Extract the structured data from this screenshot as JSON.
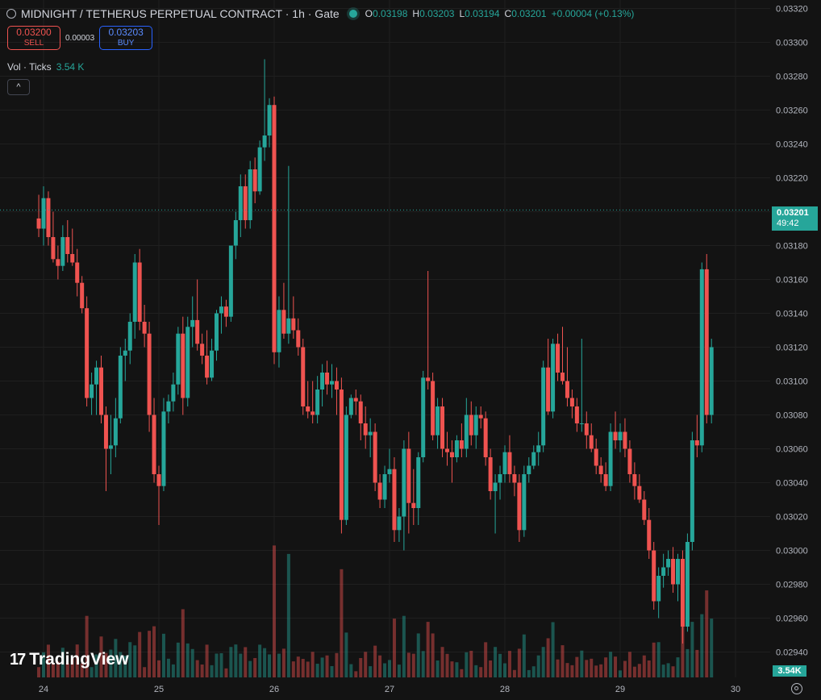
{
  "header": {
    "title": "MIDNIGHT / TETHERUS PERPETUAL CONTRACT · 1h · Gate",
    "ohlc": [
      {
        "label": "O",
        "value": "0.03198"
      },
      {
        "label": "H",
        "value": "0.03203"
      },
      {
        "label": "L",
        "value": "0.03194"
      },
      {
        "label": "C",
        "value": "0.03201"
      }
    ],
    "change": "+0.00004 (+0.13%)"
  },
  "trade": {
    "sell_price": "0.03200",
    "sell_label": "SELL",
    "spread": "0.00003",
    "buy_price": "0.03203",
    "buy_label": "BUY"
  },
  "volume": {
    "label": "Vol · Ticks",
    "value": "3.54 K",
    "tag": "3.54K"
  },
  "collapse_icon": "^",
  "last_price": {
    "value": "0.03201",
    "countdown": "49:42"
  },
  "logo": {
    "mark": "17",
    "text": "TradingView"
  },
  "colors": {
    "up": "#26a69a",
    "down": "#ef5350",
    "background": "#131313",
    "grid": "#1f1f1f"
  },
  "icons": [
    "eye-icon",
    "gear-icon",
    "chevron-up-icon"
  ],
  "chart_data": {
    "type": "candlestick",
    "interval": "1h",
    "ylim": [
      0.02925,
      0.03325
    ],
    "y_ticks": [
      "0.03320",
      "0.03300",
      "0.03280",
      "0.03260",
      "0.03240",
      "0.03220",
      "0.03200",
      "0.03180",
      "0.03160",
      "0.03140",
      "0.03120",
      "0.03100",
      "0.03080",
      "0.03060",
      "0.03040",
      "0.03020",
      "0.03000",
      "0.02980",
      "0.02960",
      "0.02940"
    ],
    "x_ticks": [
      "24",
      "25",
      "26",
      "27",
      "28",
      "29",
      "30"
    ],
    "x_ticks_start_hour": 0,
    "first_candle_hour": -1,
    "hours": 140,
    "ohlc": [
      [
        0.03196,
        0.0321,
        0.03185,
        0.0319
      ],
      [
        0.0319,
        0.03215,
        0.0318,
        0.03208
      ],
      [
        0.03208,
        0.03212,
        0.0318,
        0.03185
      ],
      [
        0.03185,
        0.032,
        0.0317,
        0.03172
      ],
      [
        0.03172,
        0.0318,
        0.0316,
        0.03168
      ],
      [
        0.03168,
        0.03192,
        0.03165,
        0.03185
      ],
      [
        0.03185,
        0.03195,
        0.0317,
        0.03175
      ],
      [
        0.03175,
        0.0319,
        0.03168,
        0.0317
      ],
      [
        0.0317,
        0.03178,
        0.0315,
        0.03158
      ],
      [
        0.03158,
        0.03162,
        0.0314,
        0.03143
      ],
      [
        0.03143,
        0.0315,
        0.03085,
        0.0309
      ],
      [
        0.0309,
        0.03105,
        0.0308,
        0.03098
      ],
      [
        0.03098,
        0.03112,
        0.0308,
        0.03108
      ],
      [
        0.03108,
        0.03115,
        0.03075,
        0.0308
      ],
      [
        0.0308,
        0.03085,
        0.03035,
        0.0306
      ],
      [
        0.0306,
        0.0308,
        0.03045,
        0.03062
      ],
      [
        0.03062,
        0.0309,
        0.03055,
        0.03078
      ],
      [
        0.03078,
        0.0312,
        0.03075,
        0.03115
      ],
      [
        0.03115,
        0.03125,
        0.031,
        0.03118
      ],
      [
        0.03118,
        0.0314,
        0.0311,
        0.03135
      ],
      [
        0.03135,
        0.03175,
        0.03125,
        0.0317
      ],
      [
        0.0317,
        0.03178,
        0.0313,
        0.03135
      ],
      [
        0.03135,
        0.03145,
        0.0312,
        0.03128
      ],
      [
        0.03128,
        0.03135,
        0.0307,
        0.0308
      ],
      [
        0.0308,
        0.0309,
        0.0304,
        0.03045
      ],
      [
        0.03045,
        0.0305,
        0.03015,
        0.03038
      ],
      [
        0.03038,
        0.0309,
        0.03035,
        0.03082
      ],
      [
        0.03082,
        0.03092,
        0.03075,
        0.03088
      ],
      [
        0.03088,
        0.03105,
        0.03082,
        0.03098
      ],
      [
        0.03098,
        0.03132,
        0.03092,
        0.03128
      ],
      [
        0.03128,
        0.03138,
        0.0308,
        0.0309
      ],
      [
        0.0309,
        0.03138,
        0.03085,
        0.03132
      ],
      [
        0.03132,
        0.0315,
        0.0312,
        0.03136
      ],
      [
        0.03136,
        0.0316,
        0.03118,
        0.03122
      ],
      [
        0.03122,
        0.03128,
        0.0311,
        0.03115
      ],
      [
        0.03115,
        0.0313,
        0.03098,
        0.03102
      ],
      [
        0.03102,
        0.03125,
        0.031,
        0.03118
      ],
      [
        0.03118,
        0.03142,
        0.03112,
        0.0314
      ],
      [
        0.0314,
        0.0315,
        0.03128,
        0.03144
      ],
      [
        0.03144,
        0.03148,
        0.03132,
        0.03138
      ],
      [
        0.03138,
        0.0317,
        0.03135,
        0.0318
      ],
      [
        0.0318,
        0.032,
        0.03172,
        0.03195
      ],
      [
        0.03195,
        0.03222,
        0.03185,
        0.03215
      ],
      [
        0.03215,
        0.03222,
        0.0319,
        0.03195
      ],
      [
        0.03195,
        0.0323,
        0.0319,
        0.03225
      ],
      [
        0.03225,
        0.03232,
        0.03205,
        0.03212
      ],
      [
        0.03212,
        0.03242,
        0.0321,
        0.03238
      ],
      [
        0.03238,
        0.0329,
        0.0323,
        0.03245
      ],
      [
        0.03245,
        0.03267,
        0.03238,
        0.03263
      ],
      [
        0.03263,
        0.03268,
        0.0311,
        0.03117
      ],
      [
        0.03117,
        0.0315,
        0.03108,
        0.03142
      ],
      [
        0.03142,
        0.03158,
        0.03125,
        0.03128
      ],
      [
        0.03128,
        0.03227,
        0.03122,
        0.03137
      ],
      [
        0.03137,
        0.0315,
        0.03125,
        0.0313
      ],
      [
        0.0313,
        0.03137,
        0.03115,
        0.0312
      ],
      [
        0.0312,
        0.03125,
        0.0308,
        0.03085
      ],
      [
        0.03085,
        0.031,
        0.03078,
        0.03082
      ],
      [
        0.03082,
        0.031,
        0.03075,
        0.0308
      ],
      [
        0.0308,
        0.03103,
        0.03075,
        0.03095
      ],
      [
        0.03095,
        0.0311,
        0.03085,
        0.03105
      ],
      [
        0.03105,
        0.03112,
        0.03092,
        0.03098
      ],
      [
        0.03098,
        0.0311,
        0.0309,
        0.031
      ],
      [
        0.031,
        0.03108,
        0.0308,
        0.03095
      ],
      [
        0.03095,
        0.03102,
        0.0301,
        0.03018
      ],
      [
        0.03018,
        0.03085,
        0.03015,
        0.0308
      ],
      [
        0.0308,
        0.03092,
        0.03078,
        0.0309
      ],
      [
        0.0309,
        0.03095,
        0.0308,
        0.03088
      ],
      [
        0.03088,
        0.03092,
        0.03065,
        0.03075
      ],
      [
        0.03075,
        0.03085,
        0.0306,
        0.03068
      ],
      [
        0.03068,
        0.03078,
        0.03055,
        0.0307
      ],
      [
        0.0307,
        0.03075,
        0.03035,
        0.0304
      ],
      [
        0.0304,
        0.03045,
        0.03025,
        0.0303
      ],
      [
        0.0303,
        0.0305,
        0.03025,
        0.03045
      ],
      [
        0.03045,
        0.0306,
        0.0304,
        0.03048
      ],
      [
        0.03048,
        0.03055,
        0.03005,
        0.03012
      ],
      [
        0.03012,
        0.03025,
        0.03005,
        0.0302
      ],
      [
        0.0302,
        0.03065,
        0.03,
        0.0306
      ],
      [
        0.0306,
        0.0307,
        0.0301,
        0.03028
      ],
      [
        0.03028,
        0.03048,
        0.03015,
        0.03025
      ],
      [
        0.03025,
        0.03058,
        0.03015,
        0.03055
      ],
      [
        0.03055,
        0.03106,
        0.03052,
        0.03102
      ],
      [
        0.03102,
        0.03165,
        0.03095,
        0.031
      ],
      [
        0.031,
        0.03105,
        0.03065,
        0.03068
      ],
      [
        0.03068,
        0.0309,
        0.0306,
        0.03085
      ],
      [
        0.03085,
        0.0309,
        0.03055,
        0.0306
      ],
      [
        0.0306,
        0.0307,
        0.0305,
        0.03058
      ],
      [
        0.03058,
        0.03065,
        0.0304,
        0.03055
      ],
      [
        0.03055,
        0.03068,
        0.03052,
        0.03065
      ],
      [
        0.03065,
        0.03075,
        0.03055,
        0.0306
      ],
      [
        0.0306,
        0.0309,
        0.03055,
        0.0308
      ],
      [
        0.0308,
        0.03088,
        0.03062,
        0.03068
      ],
      [
        0.03068,
        0.03085,
        0.0306,
        0.0308
      ],
      [
        0.0308,
        0.03085,
        0.03072,
        0.03078
      ],
      [
        0.03078,
        0.03082,
        0.0305,
        0.03055
      ],
      [
        0.03055,
        0.0306,
        0.0303,
        0.03035
      ],
      [
        0.03035,
        0.03045,
        0.0301,
        0.0304
      ],
      [
        0.0304,
        0.0305,
        0.0303,
        0.03045
      ],
      [
        0.03045,
        0.03062,
        0.0304,
        0.03058
      ],
      [
        0.03058,
        0.03068,
        0.0304,
        0.03045
      ],
      [
        0.03045,
        0.0305,
        0.03032,
        0.0304
      ],
      [
        0.0304,
        0.03045,
        0.03005,
        0.03012
      ],
      [
        0.03012,
        0.0305,
        0.03008,
        0.03045
      ],
      [
        0.03045,
        0.03055,
        0.0304,
        0.0305
      ],
      [
        0.0305,
        0.03062,
        0.03048,
        0.03058
      ],
      [
        0.03058,
        0.0307,
        0.0305,
        0.03062
      ],
      [
        0.03062,
        0.03112,
        0.03058,
        0.03108
      ],
      [
        0.03108,
        0.03125,
        0.0308,
        0.03082
      ],
      [
        0.03082,
        0.03125,
        0.03078,
        0.03122
      ],
      [
        0.03122,
        0.03128,
        0.031,
        0.03105
      ],
      [
        0.03105,
        0.03132,
        0.03098,
        0.031
      ],
      [
        0.031,
        0.0312,
        0.03085,
        0.0309
      ],
      [
        0.0309,
        0.03095,
        0.03078,
        0.03085
      ],
      [
        0.03085,
        0.0309,
        0.0307,
        0.03075
      ],
      [
        0.03075,
        0.03125,
        0.0307,
        0.03075
      ],
      [
        0.03075,
        0.03082,
        0.0306,
        0.03068
      ],
      [
        0.03068,
        0.03075,
        0.03058,
        0.0306
      ],
      [
        0.0306,
        0.03066,
        0.03045,
        0.0305
      ],
      [
        0.0305,
        0.03055,
        0.0304,
        0.03045
      ],
      [
        0.03045,
        0.03052,
        0.03035,
        0.03038
      ],
      [
        0.03038,
        0.03075,
        0.03035,
        0.0307
      ],
      [
        0.0307,
        0.03082,
        0.0306,
        0.03065
      ],
      [
        0.03065,
        0.03075,
        0.03058,
        0.0307
      ],
      [
        0.0307,
        0.03078,
        0.03055,
        0.0306
      ],
      [
        0.0306,
        0.03065,
        0.0304,
        0.03045
      ],
      [
        0.03045,
        0.03052,
        0.0303,
        0.03038
      ],
      [
        0.03038,
        0.03045,
        0.03028,
        0.0303
      ],
      [
        0.0303,
        0.03035,
        0.03015,
        0.03018
      ],
      [
        0.03018,
        0.03025,
        0.02995,
        0.03
      ],
      [
        0.03,
        0.03005,
        0.02965,
        0.0297
      ],
      [
        0.0297,
        0.0299,
        0.0296,
        0.02985
      ],
      [
        0.02985,
        0.02998,
        0.02978,
        0.0299
      ],
      [
        0.0299,
        0.03,
        0.02985,
        0.02995
      ],
      [
        0.02995,
        0.03002,
        0.02975,
        0.0298
      ],
      [
        0.0298,
        0.02998,
        0.0297,
        0.02995
      ],
      [
        0.02995,
        0.03,
        0.02945,
        0.02955
      ],
      [
        0.02955,
        0.0301,
        0.02952,
        0.03005
      ],
      [
        0.03005,
        0.0307,
        0.03,
        0.03065
      ],
      [
        0.03065,
        0.0308,
        0.03055,
        0.03062
      ],
      [
        0.03062,
        0.0317,
        0.03058,
        0.03166
      ],
      [
        0.03166,
        0.03175,
        0.03075,
        0.0308
      ],
      [
        0.0308,
        0.03125,
        0.03075,
        0.0312
      ]
    ]
  }
}
